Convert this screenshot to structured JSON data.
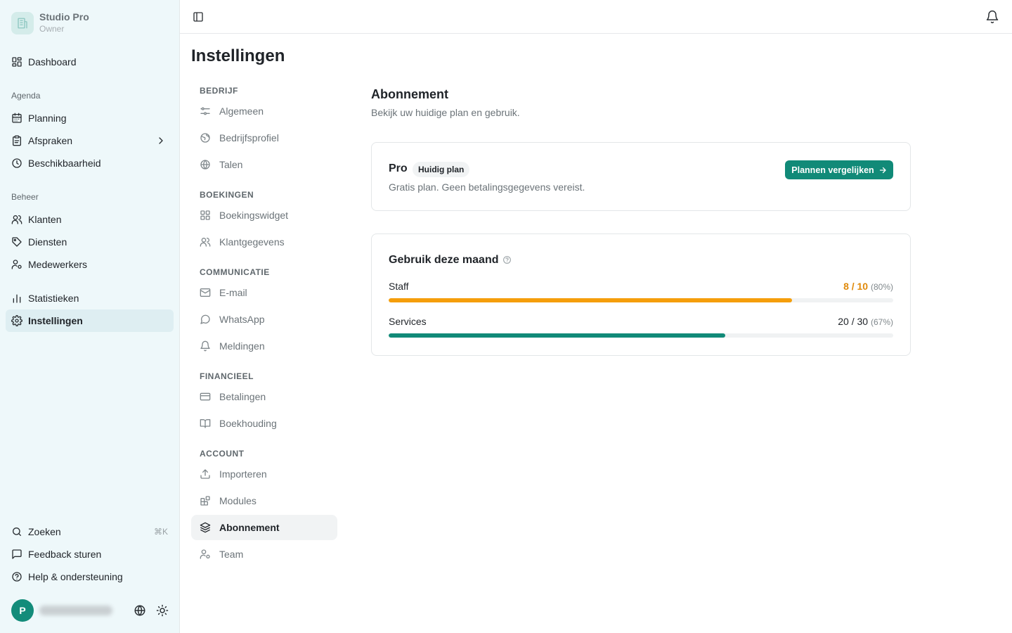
{
  "app": {
    "name": "Studio Pro",
    "role": "Owner"
  },
  "sidebar": {
    "top_items": [
      {
        "label": "Dashboard",
        "icon": "layout-grid-icon"
      }
    ],
    "groups": [
      {
        "label": "Agenda",
        "items": [
          {
            "label": "Planning",
            "icon": "calendar-icon"
          },
          {
            "label": "Afspraken",
            "icon": "clipboard-icon"
          },
          {
            "label": "Beschikbaarheid",
            "icon": "clock-icon"
          }
        ]
      },
      {
        "label": "Beheer",
        "items": [
          {
            "label": "Klanten",
            "icon": "users-icon"
          },
          {
            "label": "Diensten",
            "icon": "tag-icon"
          },
          {
            "label": "Medewerkers",
            "icon": "user-cog-icon"
          }
        ]
      }
    ],
    "bottom_items": [
      {
        "label": "Statistieken",
        "icon": "bar-chart-icon"
      },
      {
        "label": "Instellingen",
        "icon": "gear-icon",
        "active": true
      }
    ],
    "footer_items": [
      {
        "label": "Zoeken",
        "icon": "search-icon",
        "shortcut": "⌘K"
      },
      {
        "label": "Feedback sturen",
        "icon": "message-square-icon"
      },
      {
        "label": "Help & ondersteuning",
        "icon": "help-circle-icon"
      }
    ],
    "user": {
      "avatar_initial": "P"
    }
  },
  "page": {
    "title": "Instellingen"
  },
  "settings_nav": {
    "sections": [
      {
        "label": "BEDRIJF",
        "items": [
          {
            "label": "Algemeen",
            "icon": "sliders-icon"
          },
          {
            "label": "Bedrijfsprofiel",
            "icon": "globe-alt-icon"
          },
          {
            "label": "Talen",
            "icon": "globe-icon"
          }
        ]
      },
      {
        "label": "BOEKINGEN",
        "items": [
          {
            "label": "Boekingswidget",
            "icon": "layout-grid-icon"
          },
          {
            "label": "Klantgegevens",
            "icon": "users-icon"
          }
        ]
      },
      {
        "label": "COMMUNICATIE",
        "items": [
          {
            "label": "E-mail",
            "icon": "mail-icon"
          },
          {
            "label": "WhatsApp",
            "icon": "chat-bubble-icon"
          },
          {
            "label": "Meldingen",
            "icon": "bell-icon"
          }
        ]
      },
      {
        "label": "FINANCIEEL",
        "items": [
          {
            "label": "Betalingen",
            "icon": "credit-card-icon"
          },
          {
            "label": "Boekhouding",
            "icon": "book-open-icon"
          }
        ]
      },
      {
        "label": "ACCOUNT",
        "items": [
          {
            "label": "Importeren",
            "icon": "upload-icon"
          },
          {
            "label": "Modules",
            "icon": "blocks-icon"
          },
          {
            "label": "Abonnement",
            "icon": "layers-icon",
            "active": true
          },
          {
            "label": "Team",
            "icon": "user-cog-icon"
          }
        ]
      }
    ]
  },
  "subscription": {
    "title": "Abonnement",
    "description": "Bekijk uw huidige plan en gebruik.",
    "plan": {
      "name": "Pro",
      "badge": "Huidig plan",
      "description": "Gratis plan. Geen betalingsgegevens vereist.",
      "compare_button": "Plannen vergelijken"
    },
    "usage": {
      "title": "Gebruik deze maand",
      "rows": [
        {
          "label": "Staff",
          "used": "8",
          "limit": "10",
          "value_text": "8 / 10",
          "percent_text": "(80%)",
          "fraction": 0.8,
          "color": "#f59e0b",
          "warning": true
        },
        {
          "label": "Services",
          "used": "20",
          "limit": "30",
          "value_text": "20 / 30",
          "percent_text": "(67%)",
          "fraction": 0.667,
          "color": "#118a78",
          "warning": false
        }
      ]
    }
  }
}
